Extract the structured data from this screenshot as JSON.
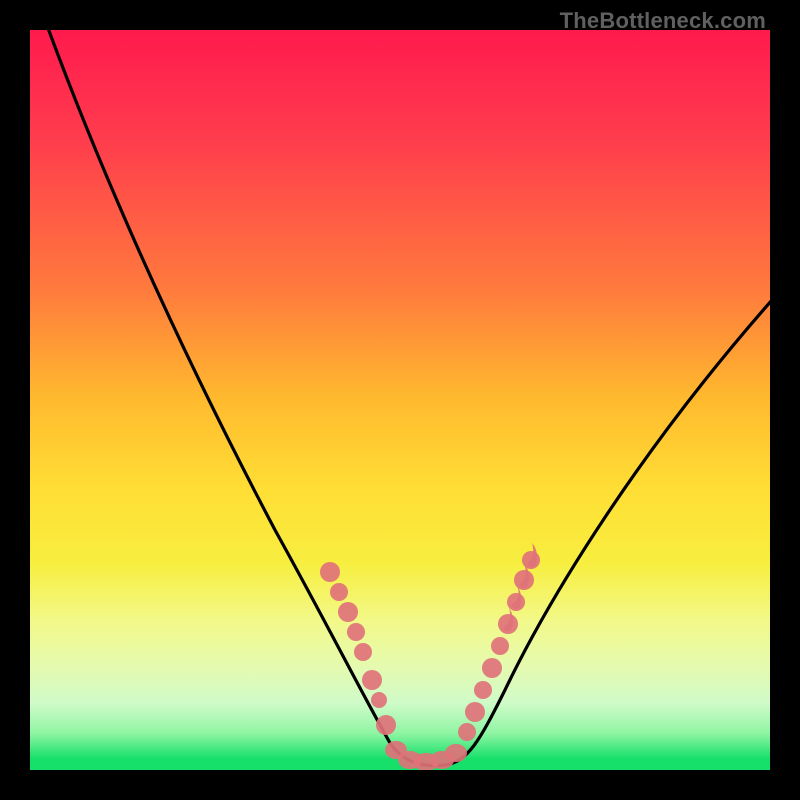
{
  "watermark": "TheBottleneck.com",
  "chart_data": {
    "type": "line",
    "title": "",
    "xlabel": "",
    "ylabel": "",
    "xlim": [
      0,
      100
    ],
    "ylim": [
      0,
      100
    ],
    "series": [
      {
        "name": "bottleneck-curve",
        "x": [
          0,
          5,
          10,
          15,
          20,
          25,
          30,
          35,
          40,
          44,
          47,
          50,
          53,
          56,
          59,
          62,
          68,
          75,
          82,
          90,
          100
        ],
        "y": [
          100,
          91,
          82,
          73,
          64,
          56,
          47,
          38,
          28,
          18,
          10,
          4,
          2,
          2,
          4,
          10,
          22,
          34,
          46,
          56,
          68
        ]
      }
    ],
    "markers": {
      "name": "highlighted-points",
      "points": [
        {
          "x": 40,
          "y": 28
        },
        {
          "x": 41.5,
          "y": 24
        },
        {
          "x": 43,
          "y": 20
        },
        {
          "x": 45,
          "y": 15
        },
        {
          "x": 46.5,
          "y": 11
        },
        {
          "x": 48,
          "y": 6
        },
        {
          "x": 50,
          "y": 2.5
        },
        {
          "x": 52,
          "y": 2
        },
        {
          "x": 54,
          "y": 2
        },
        {
          "x": 56,
          "y": 2.5
        },
        {
          "x": 58,
          "y": 5
        },
        {
          "x": 60,
          "y": 10
        },
        {
          "x": 62,
          "y": 15
        },
        {
          "x": 63.5,
          "y": 19
        },
        {
          "x": 65,
          "y": 23
        },
        {
          "x": 66.5,
          "y": 28
        }
      ]
    },
    "grid": false,
    "legend": false
  }
}
